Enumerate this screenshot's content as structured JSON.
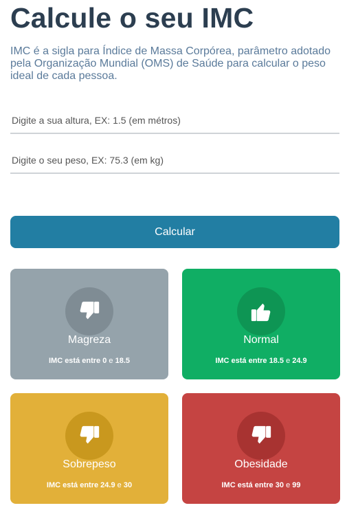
{
  "header": {
    "title": "Calcule o seu IMC",
    "description": "IMC é a sigla para Índice de Massa Corpórea, parâmetro adotado pela Organização Mundial (OMS) de Saúde para calcular o peso ideal de cada pessoa."
  },
  "form": {
    "height_placeholder": "Digite a sua altura, EX: 1.5 (em métros)",
    "weight_placeholder": "Digite o seu peso, EX: 75.3 (em kg)",
    "height_value": "",
    "weight_value": "",
    "calculate_label": "Calcular"
  },
  "cards": [
    {
      "title": "Magreza",
      "range_prefix": "IMC está entre",
      "min": "0",
      "connector": "e",
      "max": "18.5",
      "icon": "thumbs-down-icon",
      "color": "#95a3ab"
    },
    {
      "title": "Normal",
      "range_prefix": "IMC está entre",
      "min": "18.5",
      "connector": "e",
      "max": "24.9",
      "icon": "thumbs-up-icon",
      "color": "#10ae64"
    },
    {
      "title": "Sobrepeso",
      "range_prefix": "IMC está entre",
      "min": "24.9",
      "connector": "e",
      "max": "30",
      "icon": "thumbs-down-icon",
      "color": "#e2b039"
    },
    {
      "title": "Obesidade",
      "range_prefix": "IMC está entre",
      "min": "30",
      "connector": "e",
      "max": "99",
      "icon": "thumbs-down-icon",
      "color": "#c54442"
    }
  ]
}
